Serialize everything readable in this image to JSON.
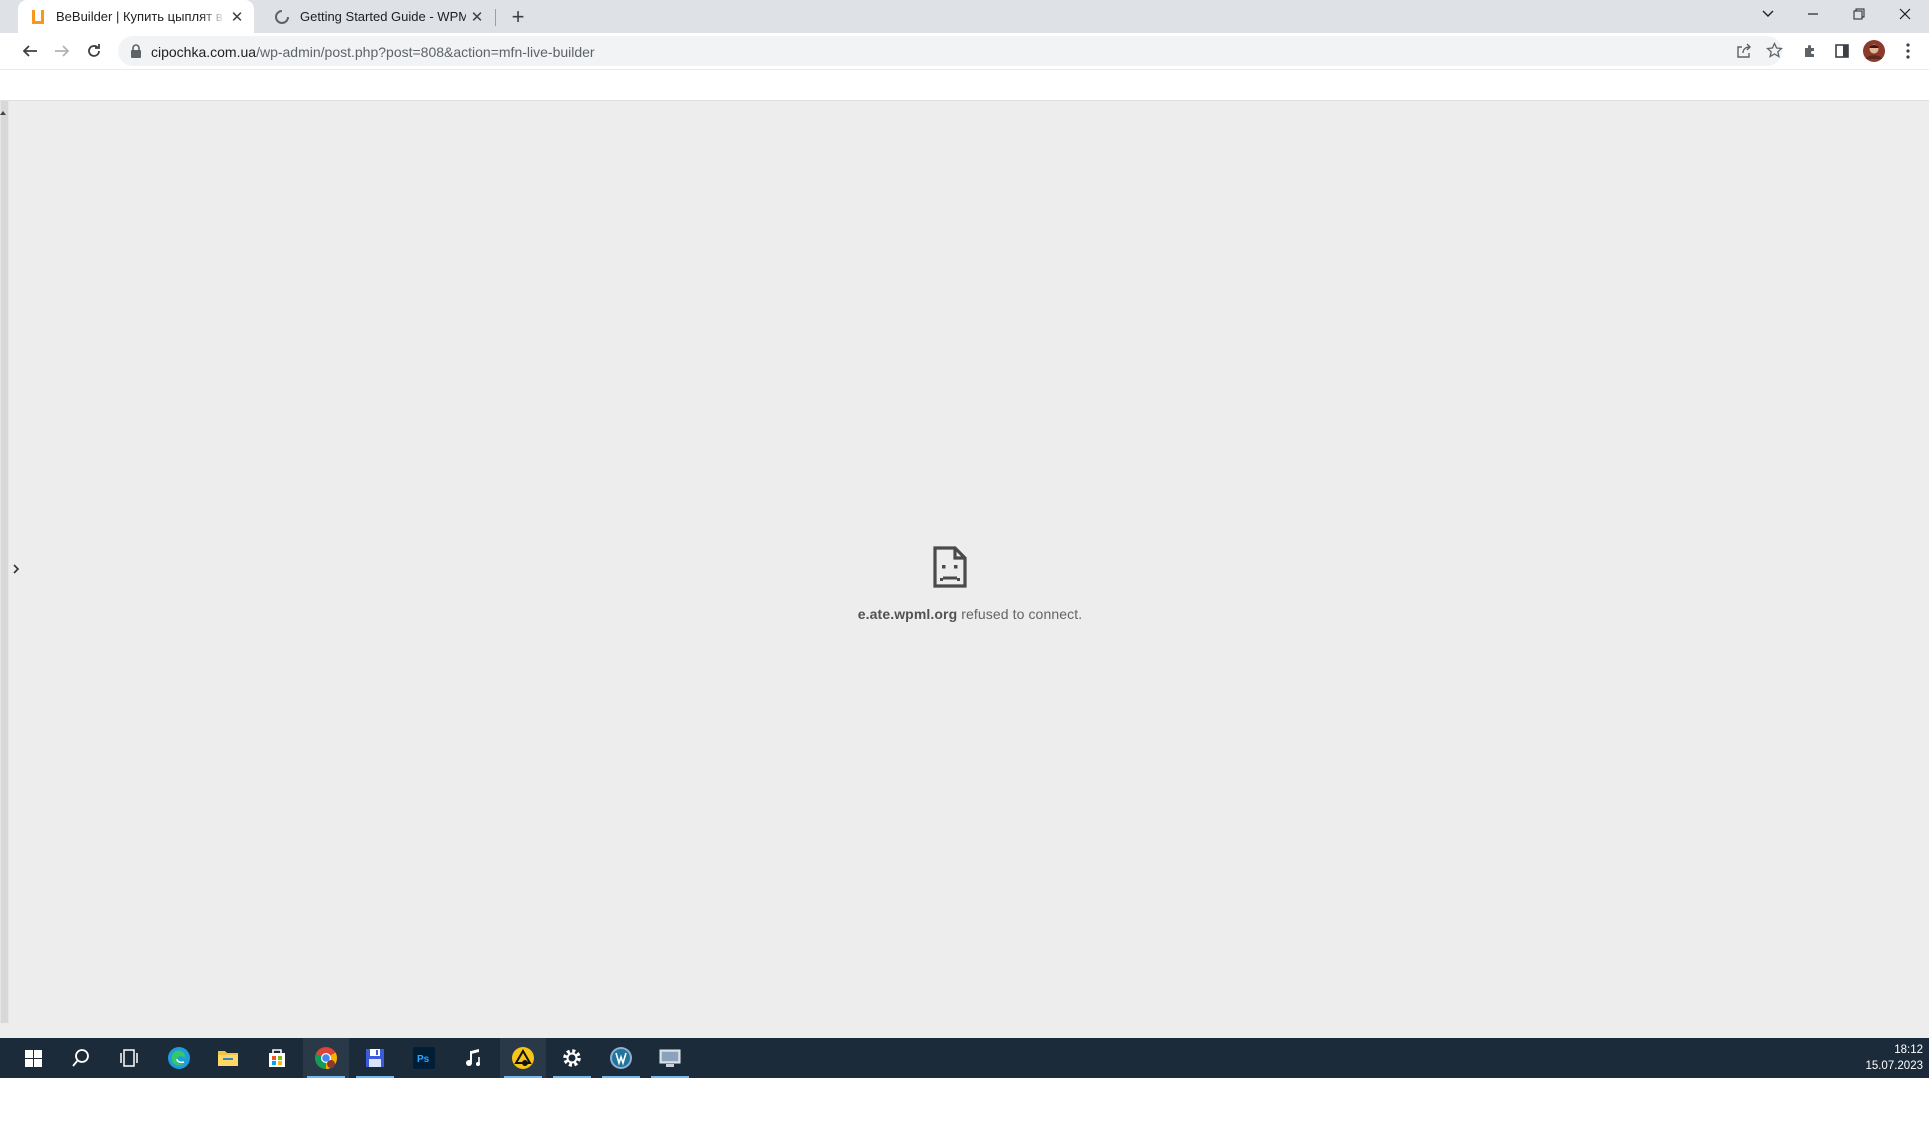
{
  "browser": {
    "tabs": [
      {
        "title": "BeBuilder | Купить цыплят в Полтаве",
        "active": true,
        "favicon": "bebuilder-logo"
      },
      {
        "title": "Getting Started Guide - WPML",
        "active": false,
        "favicon": "loading-spinner"
      }
    ],
    "new_tab_label": "+",
    "address": {
      "host": "cipochka.com.ua",
      "path": "/wp-admin/post.php?post=808&action=mfn-live-builder"
    }
  },
  "page": {
    "error_host": "e.ate.wpml.org",
    "error_message": " refused to connect."
  },
  "taskbar": {
    "apps": [
      "windows-start",
      "search",
      "task-view",
      "edge",
      "file-explorer",
      "microsoft-store",
      "chrome",
      "save-disk-app",
      "photoshop",
      "music-app",
      "gnu-like-app",
      "settings",
      "wordpress-app",
      "remote-desktop-app"
    ],
    "time": "18:12",
    "date": "15.07.2023"
  },
  "colors": {
    "accent": "#f7971e",
    "taskbar": "#1c2b3a",
    "content_bg": "#eeeded"
  }
}
